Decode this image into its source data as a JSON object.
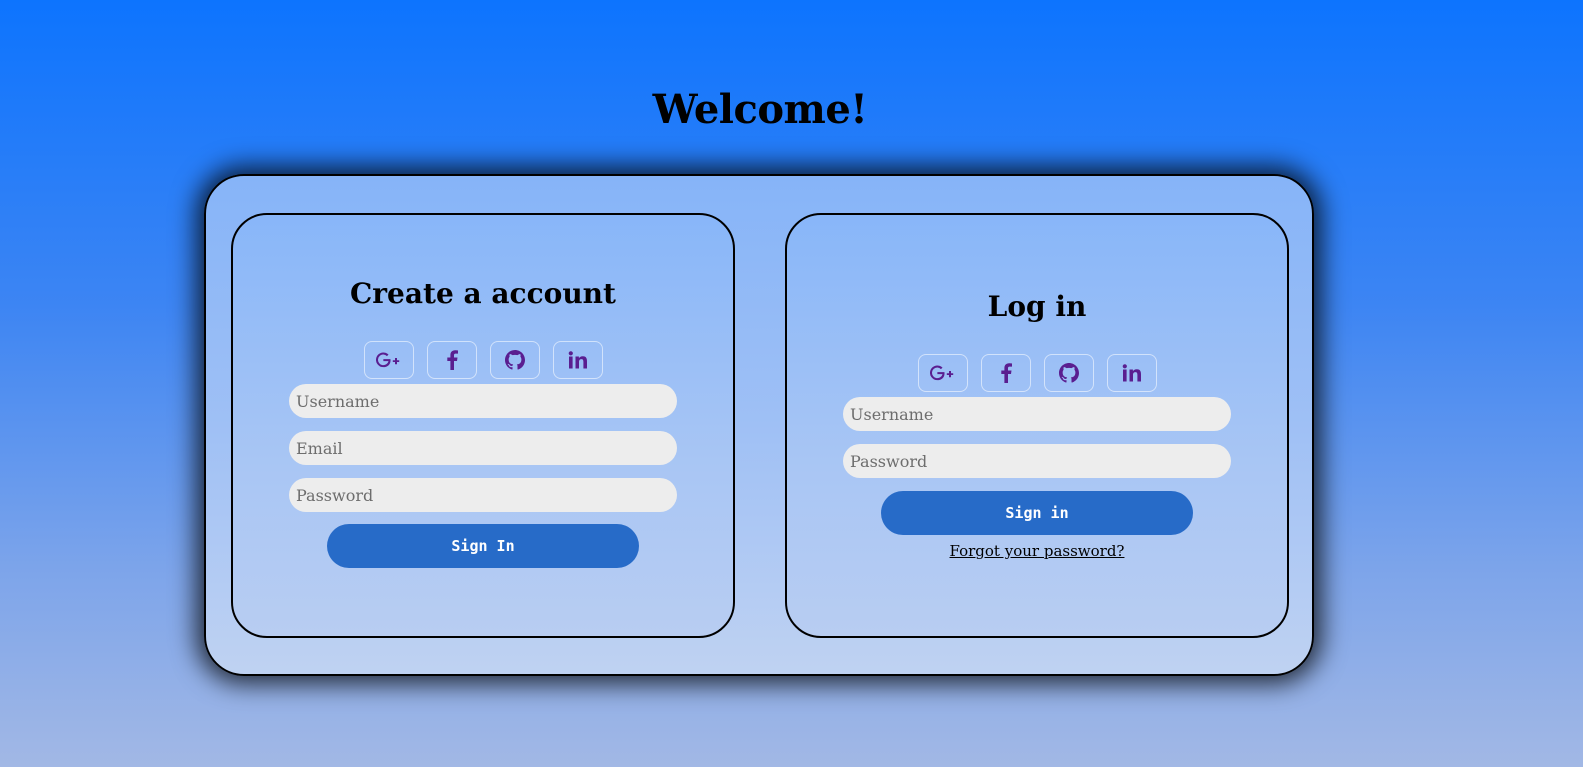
{
  "page": {
    "title": "Welcome!"
  },
  "signup": {
    "title": "Create a account",
    "social": [
      {
        "icon": "google-plus-icon",
        "glyph": "G+"
      },
      {
        "icon": "facebook-icon",
        "glyph": "f"
      },
      {
        "icon": "github-icon",
        "glyph": "github"
      },
      {
        "icon": "linkedin-icon",
        "glyph": "in"
      }
    ],
    "username_placeholder": "Username",
    "email_placeholder": "Email",
    "password_placeholder": "Password",
    "submit_label": "Sign In"
  },
  "login": {
    "title": "Log in",
    "social": [
      {
        "icon": "google-plus-icon",
        "glyph": "G+"
      },
      {
        "icon": "facebook-icon",
        "glyph": "f"
      },
      {
        "icon": "github-icon",
        "glyph": "github"
      },
      {
        "icon": "linkedin-icon",
        "glyph": "in"
      }
    ],
    "username_placeholder": "Username",
    "password_placeholder": "Password",
    "submit_label": "Sign in",
    "forgot_label": "Forgot your password?"
  },
  "colors": {
    "accent_button": "#276bc8",
    "icon_color": "#5a1e90",
    "input_bg": "#ededed"
  }
}
